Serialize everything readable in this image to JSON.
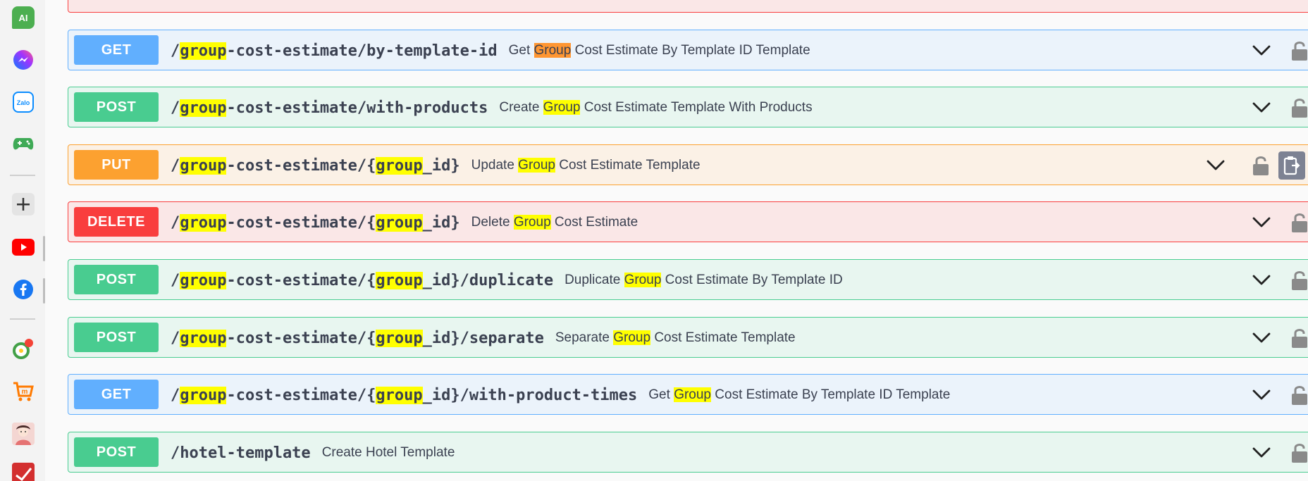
{
  "sidebar": {
    "items": [
      {
        "name": "ai-app-icon",
        "label": "AI",
        "color": "#4caf50"
      },
      {
        "name": "messenger-icon",
        "label": "",
        "color": "#7b5cff"
      },
      {
        "name": "zalo-icon",
        "label": "Zalo",
        "color": "#0a8cff"
      },
      {
        "name": "gamepad-icon",
        "label": "",
        "color": "#3faa56"
      },
      {
        "name": "add-icon",
        "label": "",
        "color": "#dcdcdc"
      },
      {
        "name": "youtube-icon",
        "label": "",
        "color": "#ff0000"
      },
      {
        "name": "facebook-icon",
        "label": "",
        "color": "#1877f2"
      },
      {
        "name": "chrome-extension-icon",
        "label": "",
        "color": "#43a047"
      },
      {
        "name": "shopping-cart-icon",
        "label": "",
        "color": "#ff7a00"
      },
      {
        "name": "avatar-icon",
        "label": "",
        "color": "#f4c7c3"
      },
      {
        "name": "red-app-icon",
        "label": "",
        "color": "#d32f2f"
      }
    ]
  },
  "operations": [
    {
      "method": "GET",
      "kind": "get",
      "path_parts": [
        "/",
        "group",
        "-cost-estimate/by-template-id"
      ],
      "desc_parts": [
        "Get ",
        "Group",
        " Cost Estimate By Template ID Template"
      ],
      "desc_highlight": "orange"
    },
    {
      "method": "POST",
      "kind": "post",
      "path_parts": [
        "/",
        "group",
        "-cost-estimate/with-products"
      ],
      "desc_parts": [
        "Create ",
        "Group",
        " Cost Estimate Template With Products"
      ]
    },
    {
      "method": "PUT",
      "kind": "put",
      "path_parts": [
        "/",
        "group",
        "-cost-estimate/{",
        "group",
        "_id}"
      ],
      "desc_parts": [
        "Update ",
        "Group",
        " Cost Estimate Template"
      ]
    },
    {
      "method": "DELETE",
      "kind": "delete",
      "path_parts": [
        "/",
        "group",
        "-cost-estimate/{",
        "group",
        "_id}"
      ],
      "desc_parts": [
        "Delete ",
        "Group",
        " Cost Estimate"
      ]
    },
    {
      "method": "POST",
      "kind": "post",
      "path_parts": [
        "/",
        "group",
        "-cost-estimate/{",
        "group",
        "_id}/duplicate"
      ],
      "desc_parts": [
        "Duplicate ",
        "Group",
        " Cost Estimate By Template ID"
      ]
    },
    {
      "method": "POST",
      "kind": "post",
      "path_parts": [
        "/",
        "group",
        "-cost-estimate/{",
        "group",
        "_id}/separate"
      ],
      "desc_parts": [
        "Separate ",
        "Group",
        " Cost Estimate Template"
      ]
    },
    {
      "method": "GET",
      "kind": "get",
      "path_parts": [
        "/",
        "group",
        "-cost-estimate/{",
        "group",
        "_id}/with-product-times"
      ],
      "desc_parts": [
        "Get ",
        "Group",
        " Cost Estimate By Template ID Template"
      ]
    },
    {
      "method": "POST",
      "kind": "post",
      "path_parts": [
        "/hotel-template"
      ],
      "desc_parts": [
        "Create Hotel Template"
      ]
    }
  ],
  "colors": {
    "get": "#61affe",
    "post": "#49cc90",
    "put": "#fca130",
    "delete": "#f93e3e",
    "highlight": "#ffff00",
    "highlight_current": "#ff9632"
  }
}
